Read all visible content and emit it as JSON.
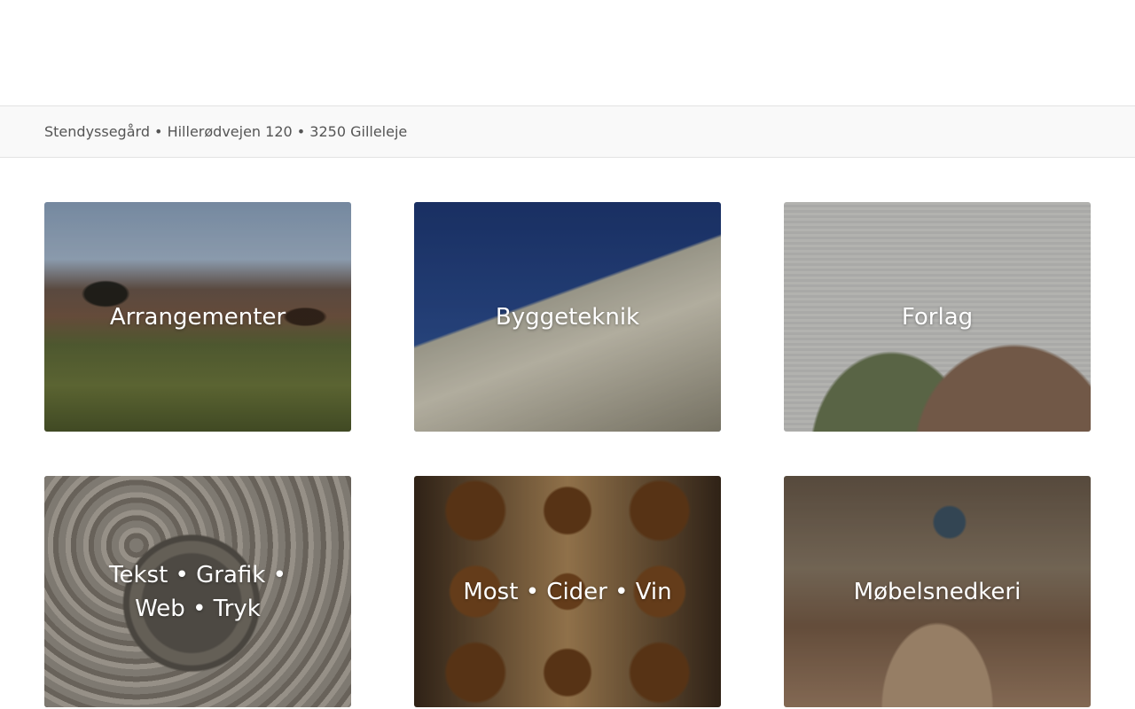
{
  "address": {
    "text": "Stendyssegård • Hillerødvejen 120 • 3250 Gilleleje"
  },
  "tiles": [
    {
      "label": "Arrangementer",
      "image": "farm-courtyard-photo"
    },
    {
      "label": "Byggeteknik",
      "image": "drone-building-photo"
    },
    {
      "label": "Forlag",
      "image": "magazine-spread-photo"
    },
    {
      "label": "Tekst • Grafik • Web • Tryk",
      "image": "manhole-cover-photo"
    },
    {
      "label": "Most • Cider • Vin",
      "image": "bottles-photo"
    },
    {
      "label": "Møbelsnedkeri",
      "image": "workshop-photo"
    }
  ]
}
